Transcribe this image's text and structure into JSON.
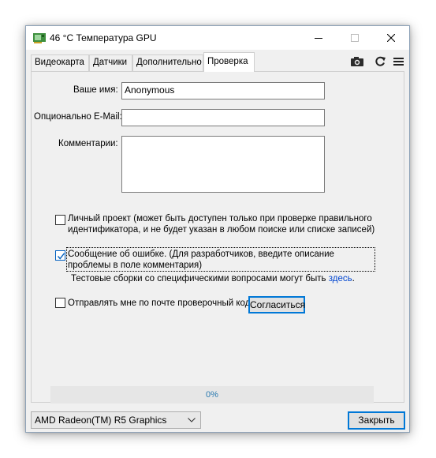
{
  "window": {
    "title": "46 °C Температура GPU"
  },
  "tabs": [
    {
      "label": "Видеокарта"
    },
    {
      "label": "Датчики"
    },
    {
      "label": "Дополнительно"
    },
    {
      "label": "Проверка",
      "active": true
    }
  ],
  "toolbar": {
    "icons": [
      "camera-icon",
      "refresh-icon",
      "hamburger-menu-icon"
    ]
  },
  "form": {
    "name_label": "Ваше имя:",
    "name_value": "Anonymous",
    "email_label": "Опционально E-Mail:",
    "email_value": "",
    "comments_label": "Комментарии:",
    "comments_value": "",
    "private_project": {
      "checked": false,
      "text": "Личный проект (может быть доступен только при проверке правильного идентификатора, и не будет указан в любом поиске или списке записей)"
    },
    "bug_report": {
      "checked": true,
      "text": "Сообщение об ошибке. (Для разработчиков, введите описание проблемы в поле комментария)"
    },
    "test_builds_text": "Тестовые сборки со специфическими вопросами могут быть",
    "test_builds_link": "здесь",
    "test_builds_period": ".",
    "email_me": {
      "checked": false,
      "text": "Отправлять мне по почте проверочный код."
    },
    "agree_button": "Согласиться"
  },
  "progress": {
    "value": 0,
    "label": "0%"
  },
  "footer": {
    "gpu_selected": "AMD Radeon(TM) R5 Graphics",
    "close_button": "Закрыть"
  },
  "colors": {
    "accent": "#0078d7",
    "link": "#0045d0",
    "progress_text": "#2a7ab0"
  }
}
